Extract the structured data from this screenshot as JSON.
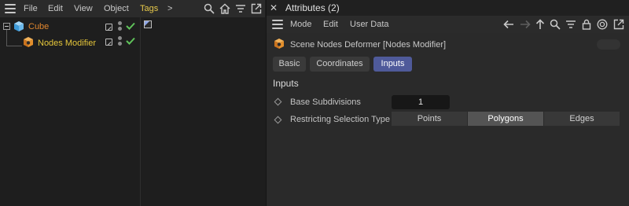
{
  "object_manager": {
    "menu": [
      "File",
      "Edit",
      "View",
      "Object",
      "Tags"
    ],
    "more_label": ">",
    "active_menu": "Tags",
    "objects": [
      {
        "name": "Cube",
        "color": "#e0862e",
        "checked": true
      },
      {
        "name": "Nodes Modifier",
        "color": "#e5c63a",
        "checked": true
      }
    ],
    "icons": [
      "menu-icon",
      "search-icon",
      "home-icon",
      "filter-icon",
      "new-window-icon"
    ]
  },
  "attributes": {
    "tab_title": "Attributes (2)",
    "close_glyph": "✕",
    "menu": [
      "Mode",
      "Edit",
      "User Data"
    ],
    "object_title": "Scene Nodes Deformer [Nodes Modifier]",
    "tabs": [
      {
        "label": "Basic",
        "selected": false
      },
      {
        "label": "Coordinates",
        "selected": false
      },
      {
        "label": "Inputs",
        "selected": true
      }
    ],
    "section": "Inputs",
    "params": {
      "base_subdivisions": {
        "label": "Base Subdivisions",
        "value": "1"
      },
      "restricting_selection_type": {
        "label": "Restricting Selection Type",
        "options": [
          "Points",
          "Polygons",
          "Edges"
        ],
        "selected": "Polygons"
      }
    },
    "toolbar_icons": [
      "back-arrow-icon",
      "forward-arrow-icon",
      "up-arrow-icon",
      "search-icon",
      "filter-icon",
      "lock-icon",
      "target-icon",
      "new-window-icon"
    ],
    "accent": "#4f5a9a"
  }
}
